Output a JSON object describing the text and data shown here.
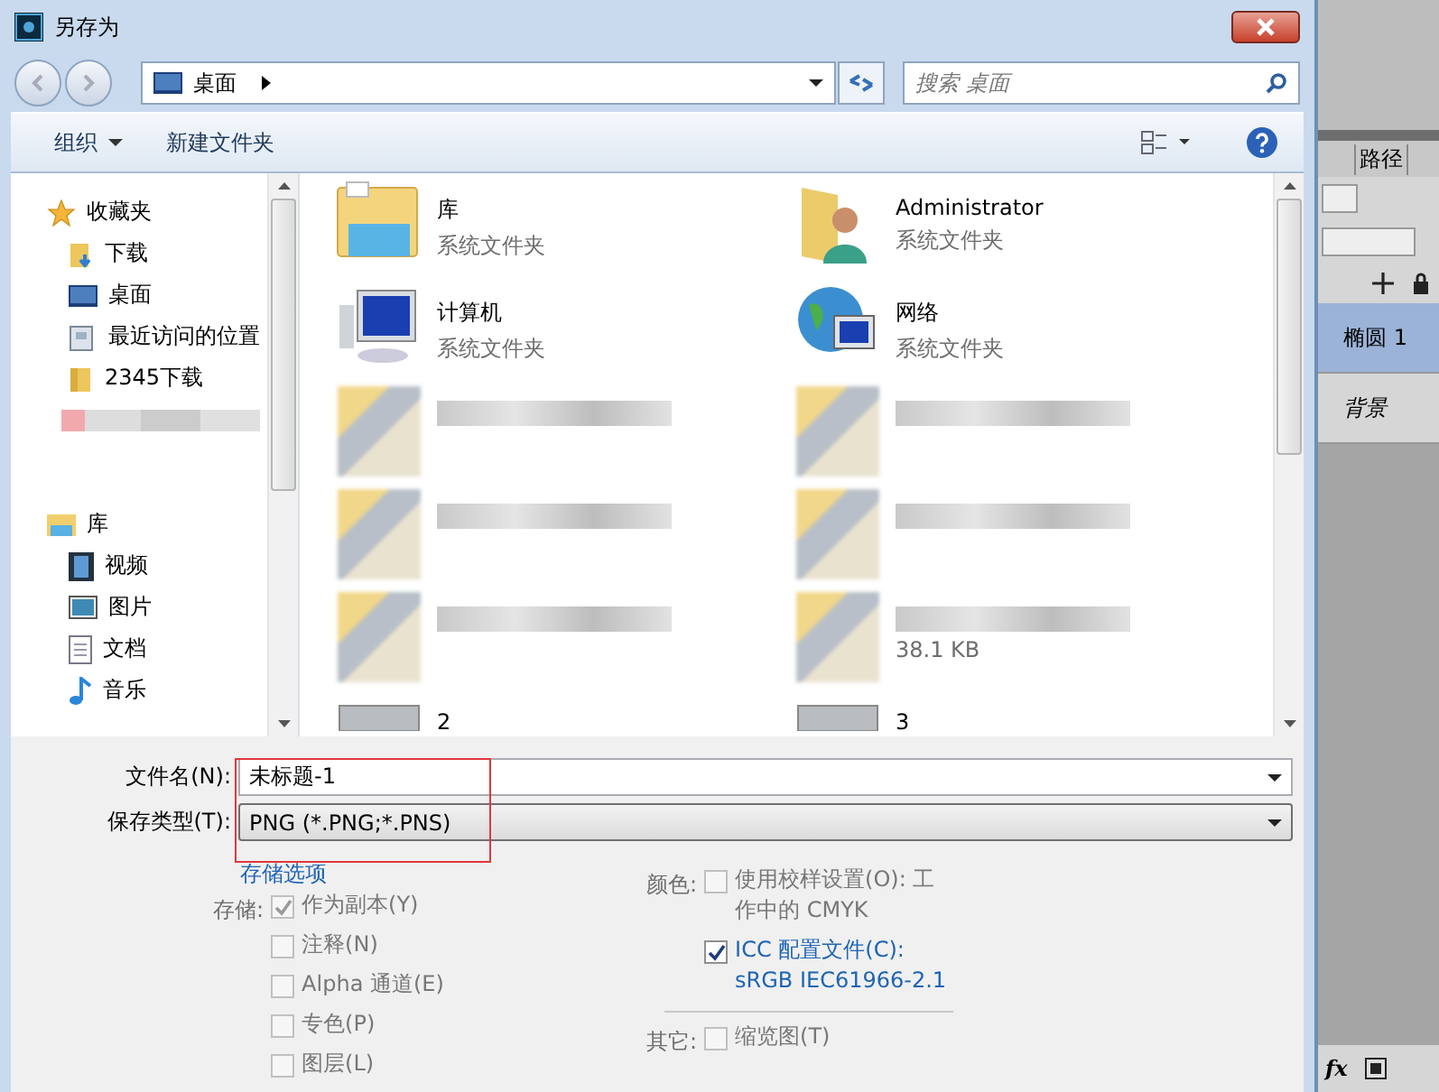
{
  "window": {
    "title": "另存为"
  },
  "address": {
    "path": "桌面",
    "search_placeholder": "搜索 桌面"
  },
  "toolbar": {
    "organize": "组织",
    "new_folder": "新建文件夹"
  },
  "nav": [
    {
      "label": "收藏夹",
      "children": [
        {
          "label": "下载"
        },
        {
          "label": "桌面"
        },
        {
          "label": "最近访问的位置"
        },
        {
          "label": "2345下载"
        }
      ]
    },
    {
      "label": "库",
      "children": [
        {
          "label": "视频"
        },
        {
          "label": "图片"
        },
        {
          "label": "文档"
        },
        {
          "label": "音乐"
        }
      ]
    }
  ],
  "files": [
    {
      "kind": "item",
      "name": "库",
      "type": "系统文件夹"
    },
    {
      "kind": "item",
      "name": "Administrator",
      "type": "系统文件夹"
    },
    {
      "kind": "item",
      "name": "计算机",
      "type": "系统文件夹"
    },
    {
      "kind": "item",
      "name": "网络",
      "type": "系统文件夹"
    },
    {
      "kind": "pixelated"
    },
    {
      "kind": "pixelated"
    },
    {
      "kind": "pixelated"
    },
    {
      "kind": "pixelated"
    },
    {
      "kind": "pixelated"
    },
    {
      "kind": "pixelated",
      "detail": "38.1 KB"
    },
    {
      "kind": "item",
      "name": "2"
    },
    {
      "kind": "item",
      "name": "3"
    }
  ],
  "form": {
    "filename_label": "文件名(N):",
    "filename": "未标题-1",
    "type_label": "保存类型(T):",
    "type": "PNG (*.PNG;*.PNS)"
  },
  "save_options": {
    "link": "存储选项",
    "groups": [
      {
        "label": "存储:",
        "items": [
          {
            "label": "作为副本(Y)",
            "checked": true,
            "disabled": true
          },
          {
            "label": "注释(N)",
            "checked": false,
            "disabled": true
          },
          {
            "label": "Alpha 通道(E)",
            "checked": false,
            "disabled": true
          },
          {
            "label": "专色(P)",
            "checked": false,
            "disabled": true
          },
          {
            "label": "图层(L)",
            "checked": false,
            "disabled": true
          }
        ]
      },
      {
        "label": "颜色:",
        "items": [
          {
            "label": "使用校样设置(O): 工作中的 CMYK",
            "checked": false,
            "disabled": true
          },
          {
            "label": "ICC 配置文件(C): sRGB IEC61966-2.1",
            "checked": true,
            "disabled": false
          }
        ]
      },
      {
        "label": "其它:",
        "items": [
          {
            "label": "缩览图(T)",
            "checked": false,
            "disabled": true
          }
        ]
      }
    ]
  },
  "photoshop_panel": {
    "tab": "路径",
    "layers": [
      {
        "name": "椭圆 1",
        "selected": true
      },
      {
        "name": "背景",
        "selected": false
      }
    ],
    "fx": "fx"
  }
}
